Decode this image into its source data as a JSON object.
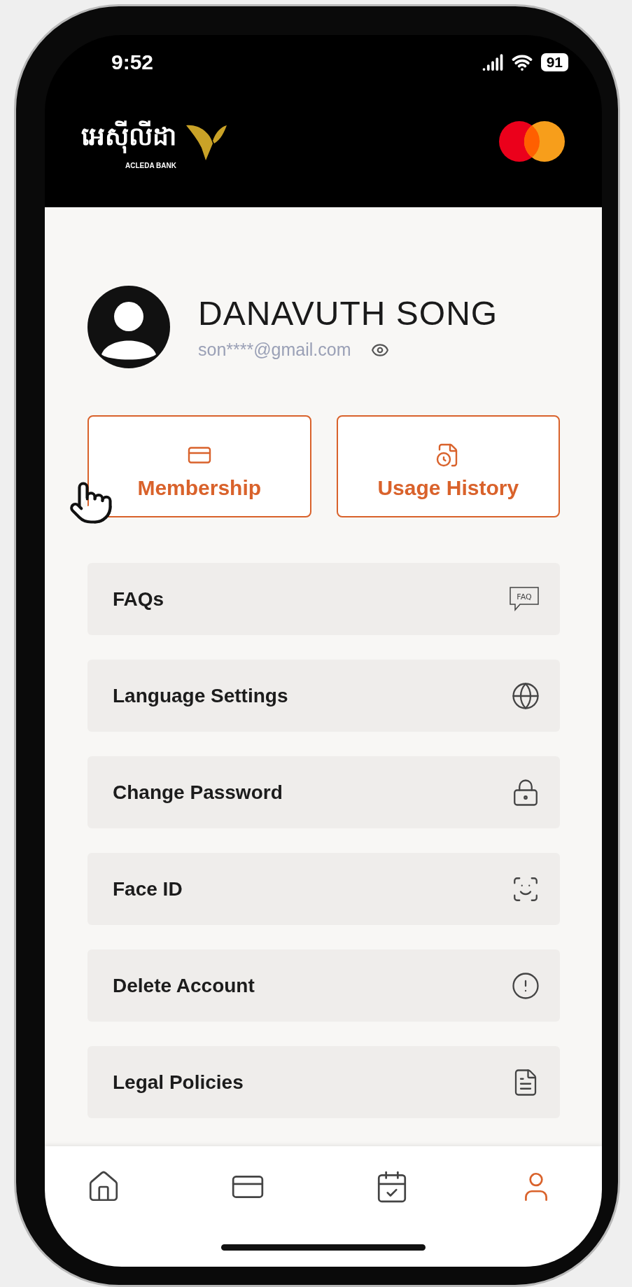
{
  "status_bar": {
    "time": "9:52",
    "battery": "91"
  },
  "header": {
    "logo_text": "អេស៊ីលីដា",
    "logo_subtext": "ACLEDA BANK"
  },
  "profile": {
    "name": "DANAVUTH SONG",
    "email": "son****@gmail.com"
  },
  "actions": [
    {
      "label": "Membership",
      "kind": "card"
    },
    {
      "label": "Usage History",
      "kind": "history"
    }
  ],
  "menu": [
    {
      "label": "FAQs",
      "kind": "faq",
      "icon_text": "FAQ"
    },
    {
      "label": "Language Settings",
      "kind": "language"
    },
    {
      "label": "Change Password",
      "kind": "password"
    },
    {
      "label": "Face ID",
      "kind": "faceid"
    },
    {
      "label": "Delete Account",
      "kind": "delete"
    },
    {
      "label": "Legal Policies",
      "kind": "legal"
    }
  ],
  "bottom_nav": [
    {
      "kind": "home",
      "selected": false
    },
    {
      "kind": "card",
      "selected": false
    },
    {
      "kind": "calendar",
      "selected": false
    },
    {
      "kind": "profile",
      "selected": true
    }
  ]
}
